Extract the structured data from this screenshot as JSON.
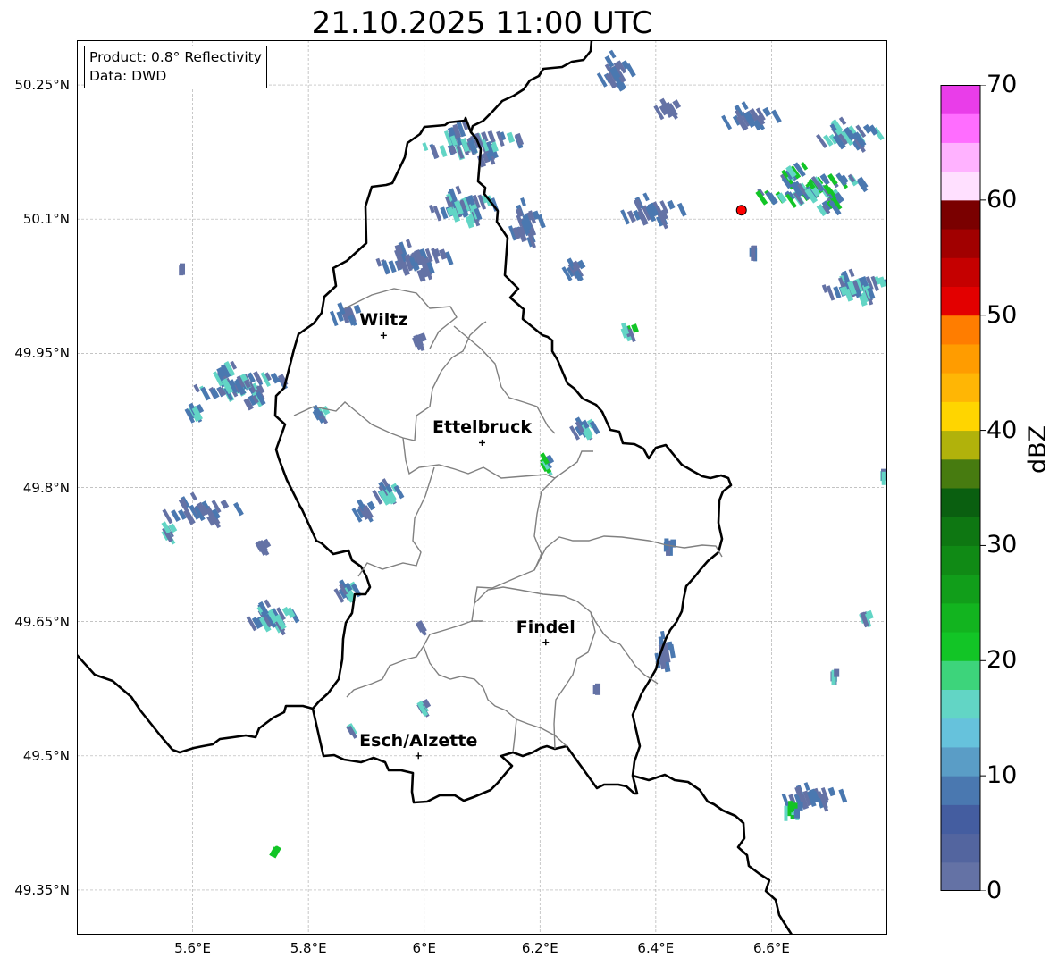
{
  "title": "21.10.2025 11:00 UTC",
  "info": {
    "product": "Product: 0.8° Reflectivity",
    "data": "Data: DWD"
  },
  "axes": {
    "lat_ticks": [
      "50.25°N",
      "50.1°N",
      "49.95°N",
      "49.8°N",
      "49.65°N",
      "49.5°N",
      "49.35°N"
    ],
    "lon_ticks": [
      "5.6°E",
      "5.8°E",
      "6°E",
      "6.2°E",
      "6.4°E",
      "6.6°E"
    ],
    "lat_range": [
      49.3,
      50.3
    ],
    "lon_range": [
      5.4,
      6.8
    ],
    "grid": true
  },
  "cities": [
    {
      "name": "Wiltz",
      "lon": 5.93,
      "lat": 49.97
    },
    {
      "name": "Ettelbruck",
      "lon": 6.1,
      "lat": 49.85
    },
    {
      "name": "Findel",
      "lon": 6.21,
      "lat": 49.627
    },
    {
      "name": "Esch/Alzette",
      "lon": 5.99,
      "lat": 49.5
    }
  ],
  "radar_site": {
    "lon": 6.548,
    "lat": 50.11,
    "color": "#ff0000"
  },
  "colorbar": {
    "label": "dBZ",
    "ticks": [
      "0",
      "10",
      "20",
      "30",
      "40",
      "50",
      "60",
      "70"
    ],
    "range": [
      0,
      70
    ],
    "colors": [
      "#6472a5",
      "#53659f",
      "#445da0",
      "#4a78b0",
      "#5a9dc6",
      "#66c2dc",
      "#62d5c5",
      "#3dd47b",
      "#12c526",
      "#12b41f",
      "#119e1a",
      "#108a15",
      "#0e7712",
      "#0a5f10",
      "#477b10",
      "#b1b20b",
      "#ffd500",
      "#ffb605",
      "#ff9c00",
      "#ff7d00",
      "#e30000",
      "#c50000",
      "#a10000",
      "#7a0000",
      "#ffe0ff",
      "#ffb2ff",
      "#ff6dff",
      "#e93de9"
    ]
  },
  "echo_colors": {
    "light": "#6472a5",
    "mid": "#4a78b0",
    "cyan": "#62d5c5",
    "green": "#12c526"
  }
}
